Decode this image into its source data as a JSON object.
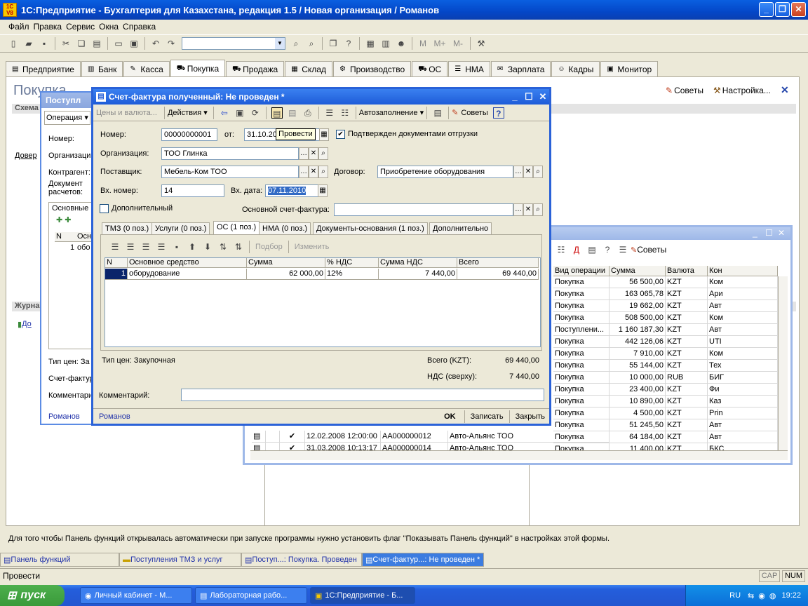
{
  "app": {
    "title": "1С:Предприятие - Бухгалтерия для Казахстана, редакция 1.5 / Новая организация / Романов",
    "logo_text": "1C V8"
  },
  "menu": [
    "Файл",
    "Правка",
    "Сервис",
    "Окна",
    "Справка"
  ],
  "toolbar_extra": {
    "m1": "M",
    "m2": "M+",
    "m3": "M-"
  },
  "tabs": [
    {
      "label": "Предприятие",
      "icon": "▤"
    },
    {
      "label": "Банк",
      "icon": "▥"
    },
    {
      "label": "Касса",
      "icon": "✎"
    },
    {
      "label": "Покупка",
      "icon": "⛟",
      "active": true
    },
    {
      "label": "Продажа",
      "icon": "⛟"
    },
    {
      "label": "Склад",
      "icon": "▦"
    },
    {
      "label": "Производство",
      "icon": "⚙"
    },
    {
      "label": "ОС",
      "icon": "⛟"
    },
    {
      "label": "НМА",
      "icon": "☰"
    },
    {
      "label": "Зарплата",
      "icon": "✉"
    },
    {
      "label": "Кадры",
      "icon": "☺"
    },
    {
      "label": "Монитор",
      "icon": "▣"
    }
  ],
  "panel": {
    "title": "Покупка",
    "sovety": "Советы",
    "nastroika": "Настройка...",
    "schema_label": "Схема",
    "dover_link": "Довер",
    "journal_label": "Журна",
    "do_link": "До"
  },
  "back_window": {
    "title": "Поступл",
    "operacia": "Операция",
    "nomer": "Номер:",
    "organizacia": "Организаци",
    "kontragent": "Контрагент:",
    "document": "Документ",
    "raschetov": "расчетов:",
    "osnovnye": "Основные",
    "n_col": "N",
    "osn_col": "Осн",
    "row_n": "1",
    "row_val": "обо",
    "tip_cen": "Тип цен: За",
    "schet_f": "Счет-фактур",
    "komment": "Комментари",
    "user": "Романов"
  },
  "dialog": {
    "title": "Счет-фактура полученный: Не проведен *",
    "toolbar": {
      "ceny": "Цены и валюта...",
      "deistviya": "Действия",
      "avtozap": "Автозаполнение",
      "sovety": "Советы"
    },
    "tooltip": "Провести",
    "labels": {
      "nomer": "Номер:",
      "ot": "от:",
      "org": "Организация:",
      "post": "Поставщик:",
      "dogovor": "Договор:",
      "vx_nomer": "Вх. номер:",
      "vx_data": "Вх. дата:",
      "dopoln": "Дополнительный",
      "osn_sf": "Основной счет-фактура:",
      "podtv": "Подтвержден документами отгрузки"
    },
    "values": {
      "nomer": "00000000001",
      "date": "31.10.20",
      "org": "ТОО Глинка",
      "post": "Мебель-Ком ТОО",
      "dogovor": "Приобретение оборудования",
      "vx_nomer": "14",
      "vx_data": "07.11.2010"
    },
    "inner_tabs": [
      {
        "label": "ТМЗ (0 поз.)"
      },
      {
        "label": "Услуги (0 поз.)"
      },
      {
        "label": "ОС (1 поз.)",
        "active": true
      },
      {
        "label": "НМА (0 поз.)"
      },
      {
        "label": "Документы-основания (1 поз.)"
      },
      {
        "label": "Дополнительно"
      }
    ],
    "grid_toolbar": {
      "podbor": "Подбор",
      "izmenit": "Изменить"
    },
    "grid_headers": [
      "N",
      "Основное средство",
      "Сумма",
      "% НДС",
      "Сумма НДС",
      "Всего"
    ],
    "grid_rows": [
      [
        "1",
        "оборудование",
        "62 000,00",
        "12%",
        "7 440,00",
        "69 440,00"
      ]
    ],
    "tip_cen": "Тип цен: Закупочная",
    "vsego_lbl": "Всего (KZT):",
    "vsego_val": "69 440,00",
    "nds_lbl": "НДС (сверху):",
    "nds_val": "7 440,00",
    "komment_lbl": "Комментарий:",
    "user": "Романов",
    "buttons": {
      "ok": "OK",
      "zapisat": "Записать",
      "zakryt": "Закрыть"
    }
  },
  "list_window": {
    "sovety": "Советы",
    "headers": [
      "Вид операции",
      "Сумма",
      "Валюта",
      "Кон"
    ],
    "rows": [
      [
        "Покупка",
        "56 500,00",
        "KZT",
        "Ком"
      ],
      [
        "Покупка",
        "163 065,78",
        "KZT",
        "Ари"
      ],
      [
        "Покупка",
        "19 662,00",
        "KZT",
        "Авт"
      ],
      [
        "Покупка",
        "508 500,00",
        "KZT",
        "Ком"
      ],
      [
        "Поступлени...",
        "1 160 187,30",
        "KZT",
        "Авт"
      ],
      [
        "Покупка",
        "442 126,06",
        "KZT",
        "UTI"
      ],
      [
        "Покупка",
        "7 910,00",
        "KZT",
        "Ком"
      ],
      [
        "Покупка",
        "55 144,00",
        "KZT",
        "Тех"
      ],
      [
        "Покупка",
        "10 000,00",
        "RUB",
        "БИГ"
      ],
      [
        "Покупка",
        "23 400,00",
        "KZT",
        "Фи"
      ],
      [
        "Покупка",
        "10 890,00",
        "KZT",
        "Каз"
      ],
      [
        "Покупка",
        "4 500,00",
        "KZT",
        "Prin"
      ],
      [
        "Покупка",
        "51 245,50",
        "KZT",
        "Авт"
      ],
      [
        "Покупка",
        "64 184,00",
        "KZT",
        "Авт"
      ],
      [
        "Покупка",
        "11 400,00",
        "KZT",
        "БКС"
      ]
    ],
    "extra_rows": [
      {
        "date": "12.02.2008 12:00:00",
        "num": "АА000000012",
        "kontr": "Авто-Альянс ТОО"
      },
      {
        "date": "31.03.2008 10:13:17",
        "num": "АА000000014",
        "kontr": "Авто-Альянс ТОО"
      }
    ]
  },
  "status_message": "Для того чтобы Панель функций открывалась автоматически при запуске программы нужно установить флаг \"Показывать Панель функций\" в настройках этой формы.",
  "window_tabs": [
    {
      "label": "Панель функций"
    },
    {
      "label": "Поступления ТМЗ и услуг"
    },
    {
      "label": "Поступ...: Покупка. Проведен"
    },
    {
      "label": "Счет-фактур...: Не проведен *",
      "active": true
    }
  ],
  "statusbar": {
    "text": "Провести",
    "cap": "CAP",
    "num": "NUM"
  },
  "taskbar": {
    "start": "пуск",
    "buttons": [
      {
        "label": "Личный кабинет - М..."
      },
      {
        "label": "Лабораторная рабо..."
      },
      {
        "label": "1С:Предприятие - Б...",
        "active": true
      }
    ],
    "lang": "RU",
    "time": "19:22"
  }
}
